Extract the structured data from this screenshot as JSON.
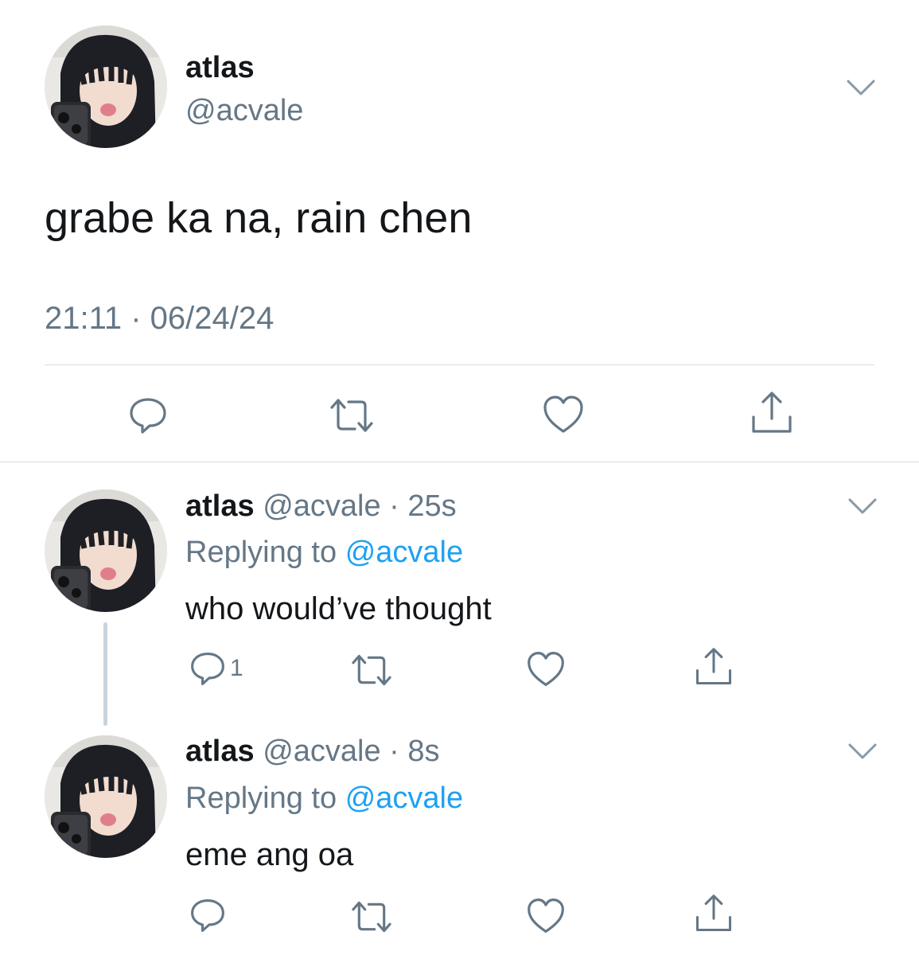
{
  "main_tweet": {
    "name": "atlas",
    "handle": "@acvale",
    "text": "grabe ka na, rain chen",
    "timestamp": "21:11 · 06/24/24",
    "icons": {
      "menu": "chevron-down-icon",
      "reply": "reply-icon",
      "retweet": "retweet-icon",
      "like": "heart-icon",
      "share": "share-icon"
    }
  },
  "replies": [
    {
      "name": "atlas",
      "handle": "@acvale",
      "time": "25s",
      "replying_prefix": "Replying to",
      "replying_to": "@acvale",
      "text": "who would’ve thought",
      "reply_count": "1"
    },
    {
      "name": "atlas",
      "handle": "@acvale",
      "time": "8s",
      "replying_prefix": "Replying to",
      "replying_to": "@acvale",
      "text": "eme ang oa",
      "reply_count": ""
    }
  ],
  "colors": {
    "text": "#14171a",
    "muted": "#657786",
    "link": "#1da1f2",
    "divider": "#d6dde3"
  }
}
